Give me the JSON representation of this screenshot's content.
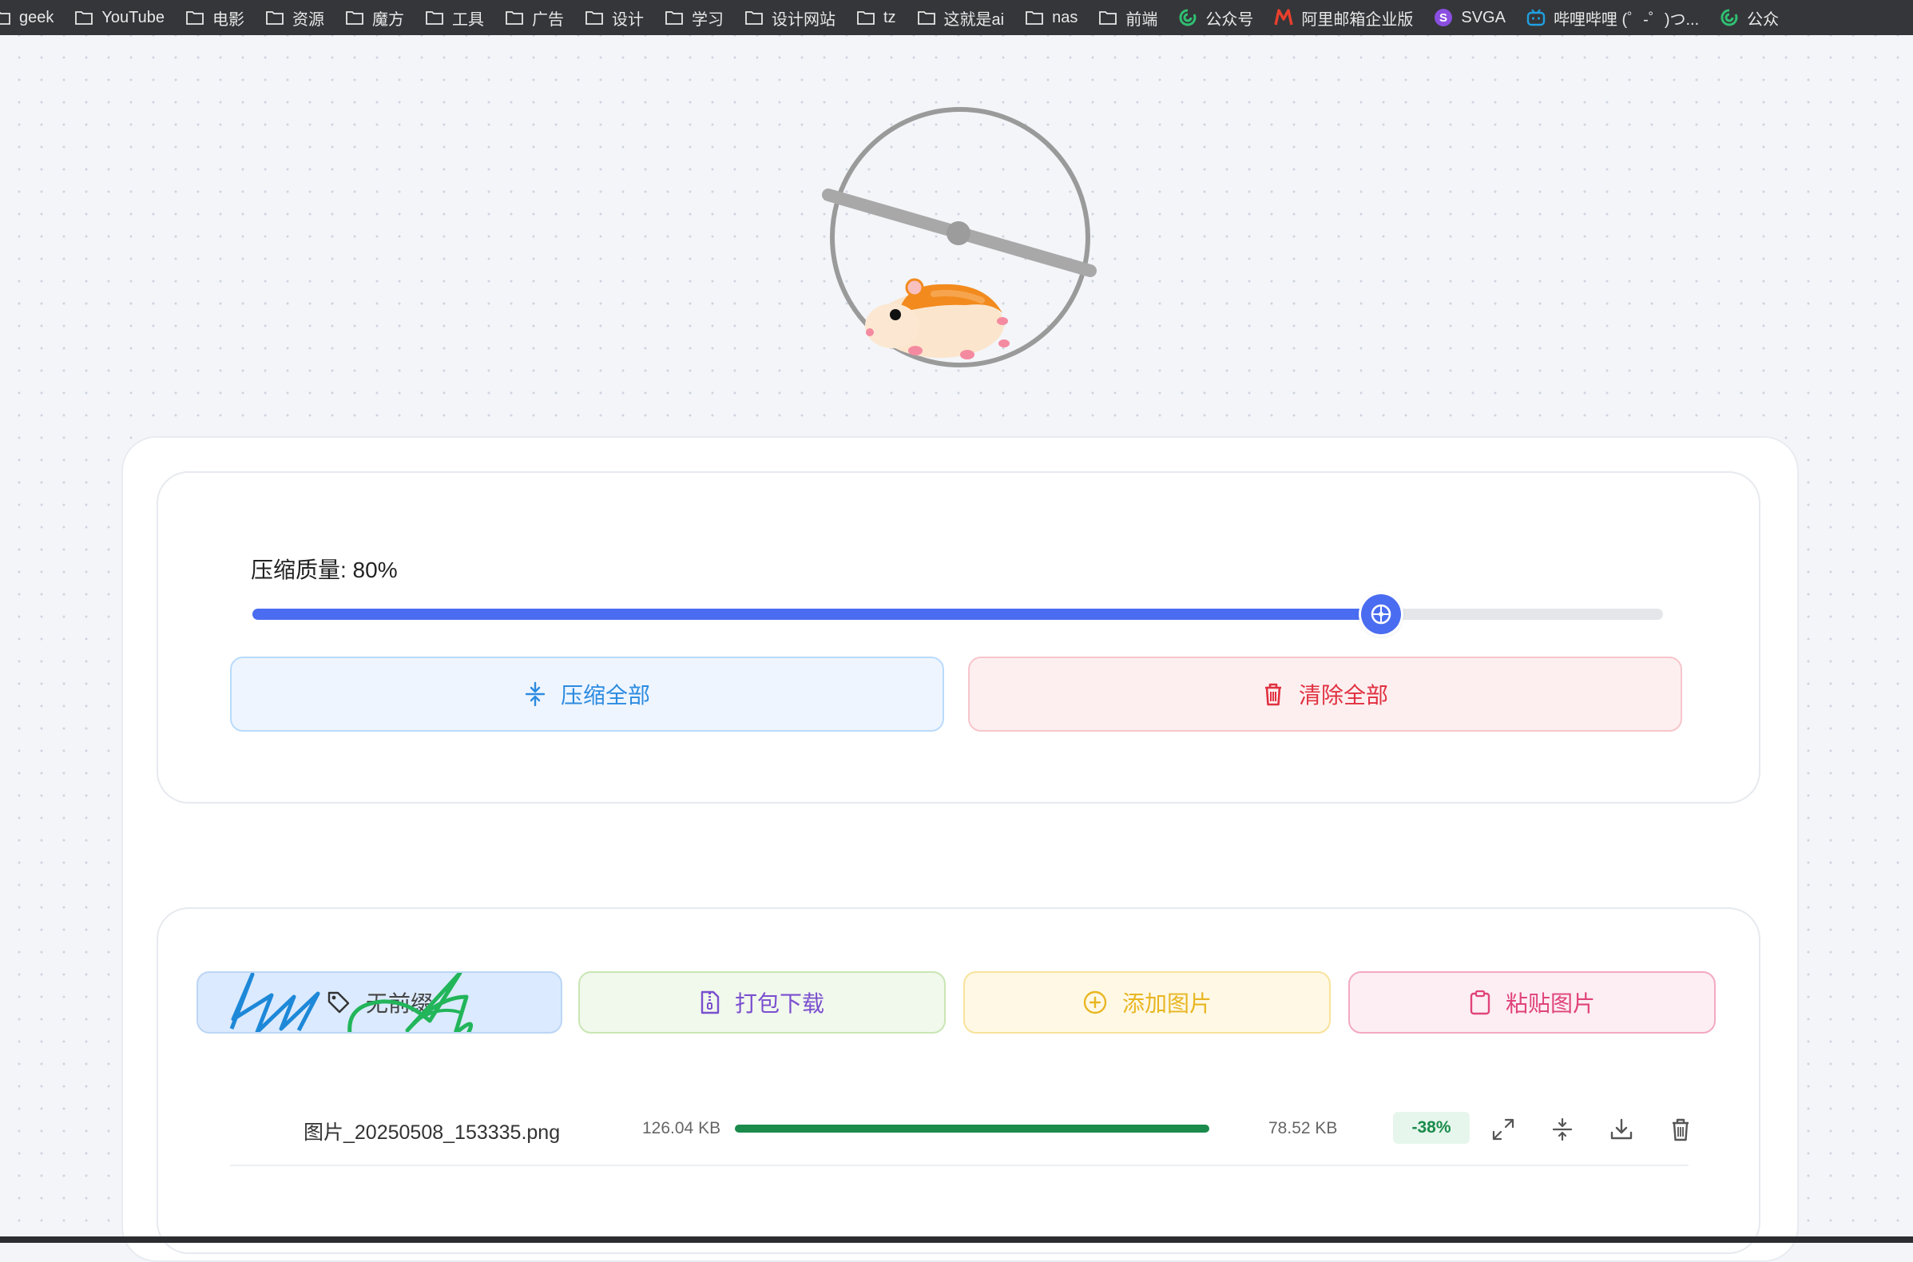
{
  "bookmarks": [
    {
      "label": "geek",
      "icon": "folder-icon"
    },
    {
      "label": "YouTube",
      "icon": "folder-icon"
    },
    {
      "label": "电影",
      "icon": "folder-icon"
    },
    {
      "label": "资源",
      "icon": "folder-icon"
    },
    {
      "label": "魔方",
      "icon": "folder-icon"
    },
    {
      "label": "工具",
      "icon": "folder-icon"
    },
    {
      "label": "广告",
      "icon": "folder-icon"
    },
    {
      "label": "设计",
      "icon": "folder-icon"
    },
    {
      "label": "学习",
      "icon": "folder-icon"
    },
    {
      "label": "设计网站",
      "icon": "folder-icon"
    },
    {
      "label": "tz",
      "icon": "folder-icon"
    },
    {
      "label": "这就是ai",
      "icon": "folder-icon"
    },
    {
      "label": "nas",
      "icon": "folder-icon"
    },
    {
      "label": "前端",
      "icon": "folder-icon"
    },
    {
      "label": "公众号",
      "icon": "wechat-icon"
    },
    {
      "label": "阿里邮箱企业版",
      "icon": "mail-icon"
    },
    {
      "label": "SVGA",
      "icon": "svga-icon"
    },
    {
      "label": "哔哩哔哩 (゜-゜)つ...",
      "icon": "bilibili-icon"
    },
    {
      "label": "公众",
      "icon": "wechat-icon"
    }
  ],
  "quality": {
    "label": "压缩质量: 80%",
    "value": 80
  },
  "actions": {
    "compress_all": "压缩全部",
    "clear_all": "清除全部",
    "no_preview": "无前缀",
    "zip_download": "打包下载",
    "add_image": "添加图片",
    "paste_image": "粘贴图片"
  },
  "files": [
    {
      "name": "图片_20250508_153335.png",
      "original_size": "126.04 KB",
      "compressed_size": "78.52 KB",
      "reduction": "-38%",
      "progress": 100
    }
  ],
  "colors": {
    "accent": "#4a6cf0",
    "compress": "#2c8be0",
    "clear": "#e03140",
    "zip": "#7a4fcf",
    "add": "#e8b622",
    "paste": "#e0437a",
    "success": "#1b8b4c"
  }
}
